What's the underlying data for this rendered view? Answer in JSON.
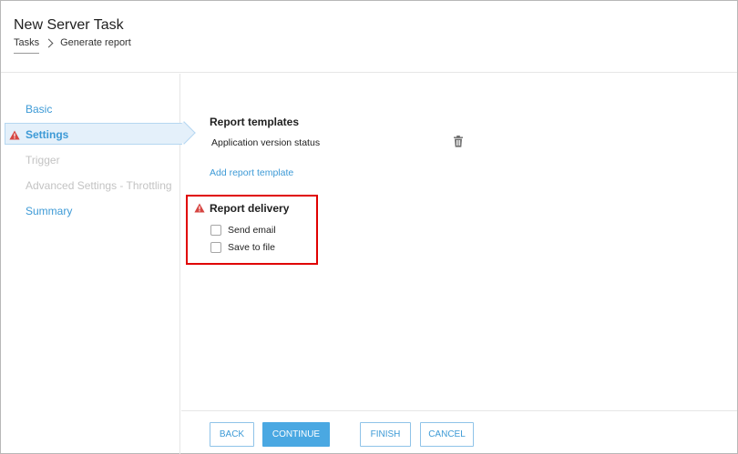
{
  "window": {
    "title": "New Server Task"
  },
  "breadcrumb": {
    "items": [
      "Tasks",
      "Generate report"
    ]
  },
  "sidebar": {
    "items": [
      {
        "label": "Basic",
        "state": "link"
      },
      {
        "label": "Settings",
        "state": "active",
        "warning": true
      },
      {
        "label": "Trigger",
        "state": "disabled"
      },
      {
        "label": "Advanced Settings - Throttling",
        "state": "disabled"
      },
      {
        "label": "Summary",
        "state": "link"
      }
    ]
  },
  "main": {
    "report_templates": {
      "title": "Report templates",
      "items": [
        {
          "name": "Application version status",
          "action_icon": "trash-icon"
        }
      ],
      "add_link": "Add report template"
    },
    "report_delivery": {
      "title": "Report delivery",
      "warning": true,
      "options": [
        {
          "label": "Send email",
          "checked": false
        },
        {
          "label": "Save to file",
          "checked": false
        }
      ]
    }
  },
  "footer": {
    "buttons": [
      "BACK",
      "CONTINUE",
      "FINISH",
      "CANCEL"
    ],
    "primary": "CONTINUE"
  },
  "colors": {
    "accent": "#3d9ad6",
    "warning": "#d64541",
    "highlight": "#e00000",
    "primary_button": "#4aa8e2"
  }
}
